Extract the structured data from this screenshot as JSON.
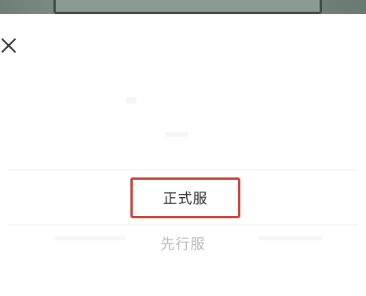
{
  "dialog": {
    "close_icon": "close-icon",
    "options": [
      {
        "label": "正式服",
        "selected": true
      },
      {
        "label": "先行服",
        "selected": false
      }
    ]
  },
  "colors": {
    "highlight_border": "#c8423a",
    "option_text": "#2b2b2b",
    "option_text_muted": "#b9b9b9"
  }
}
